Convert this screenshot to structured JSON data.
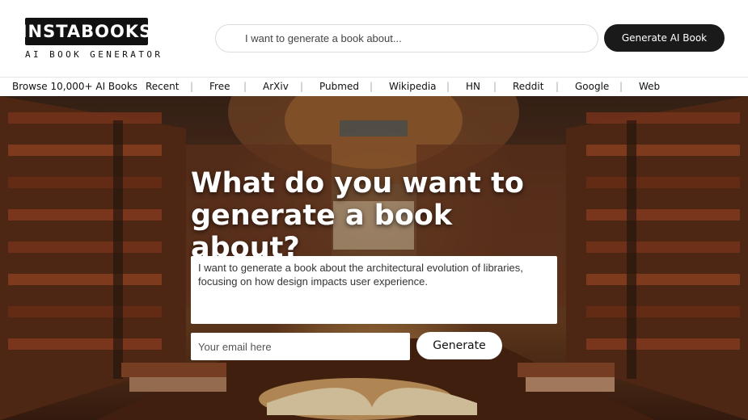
{
  "logo": {
    "title": "INSTABOOKS",
    "subtitle": "AI BOOK GENERATOR"
  },
  "header": {
    "search_placeholder": "I want to generate a book about...",
    "generate_ai_book_label": "Generate AI Book"
  },
  "nav": {
    "items": [
      {
        "label": "Browse 10,000+ AI Books"
      },
      {
        "label": "Recent"
      },
      {
        "label": "Free"
      },
      {
        "label": "ArXiv"
      },
      {
        "label": "Pubmed"
      },
      {
        "label": "Wikipedia"
      },
      {
        "label": "HN"
      },
      {
        "label": "Reddit"
      },
      {
        "label": "Google"
      },
      {
        "label": "Web"
      }
    ],
    "separator": "|"
  },
  "hero": {
    "title": "What do you want to generate a book about?",
    "topic_value": "I want to generate a book about the architectural evolution of libraries, focusing on how design impacts user experience.",
    "email_placeholder": "Your email here",
    "generate_label": "Generate"
  }
}
